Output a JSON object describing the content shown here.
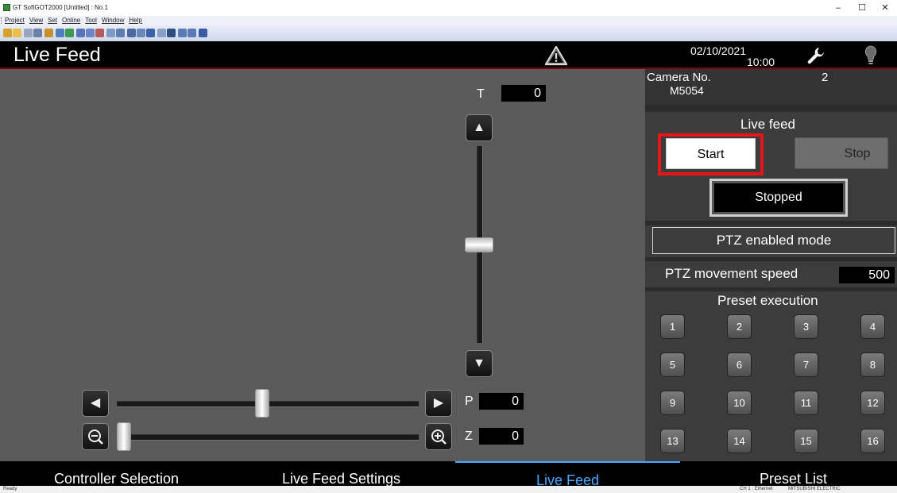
{
  "window": {
    "title": "GT SoftGOT2000 [Untitled] : No.1",
    "menu": [
      "Project",
      "View",
      "Set",
      "Online",
      "Tool",
      "Window",
      "Help"
    ],
    "controls": {
      "minimize": "–",
      "maximize": "☐",
      "close": "✕"
    }
  },
  "header": {
    "title": "Live Feed",
    "date": "02/10/2021",
    "time": "10:00",
    "icons": [
      "warning-icon",
      "wrench-icon",
      "lightbulb-icon"
    ]
  },
  "ptz": {
    "tilt_label": "T",
    "tilt_value": "0",
    "tilt_level": 0.5,
    "pan_label": "P",
    "pan_value": "0",
    "pan_level": 0.5,
    "zoom_label": "Z",
    "zoom_value": "0",
    "zoom_level": 0.0,
    "up_glyph": "▲",
    "down_glyph": "▼",
    "left_glyph": "◀",
    "right_glyph": "▶"
  },
  "camera": {
    "label": "Camera No.",
    "number": "2",
    "model": "M5054"
  },
  "live_feed": {
    "title": "Live feed",
    "start_label": "Start",
    "stop_label": "Stop",
    "status": "Stopped"
  },
  "ptz_mode": "PTZ enabled mode",
  "speed": {
    "label": "PTZ movement speed",
    "value": "500"
  },
  "presets": {
    "title": "Preset execution",
    "items": [
      "1",
      "2",
      "3",
      "4",
      "5",
      "6",
      "7",
      "8",
      "9",
      "10",
      "11",
      "12",
      "13",
      "14",
      "15",
      "16"
    ]
  },
  "tabs": [
    {
      "label": "Controller Selection"
    },
    {
      "label": "Live Feed Settings"
    },
    {
      "label": "Live Feed"
    },
    {
      "label": "Preset List"
    }
  ],
  "status": {
    "left": "Ready",
    "channel": "CH 1 : Ethernet",
    "vendor": "MITSUBISHI ELECTRIC"
  },
  "colors": {
    "accent_tab": "#4aa8ff",
    "highlight_box": "#e8141b",
    "header_bg": "#000000"
  }
}
